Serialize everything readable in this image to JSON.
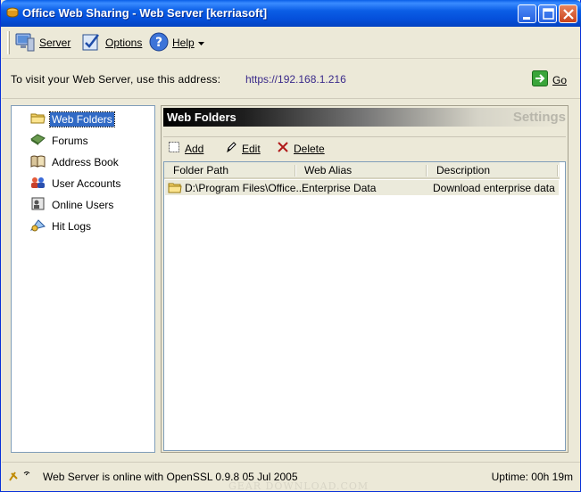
{
  "window": {
    "title": "Office Web Sharing - Web Server [kerriasoft]"
  },
  "toolbar": {
    "server_label": "Server",
    "options_label": "Options",
    "help_label": "Help"
  },
  "address": {
    "label": "To visit your Web Server, use this address:",
    "url": "https://192.168.1.216",
    "go_label": "Go"
  },
  "nav": {
    "items": [
      {
        "label": "Web Folders",
        "icon": "folder-icon",
        "selected": true
      },
      {
        "label": "Forums",
        "icon": "forums-icon"
      },
      {
        "label": "Address Book",
        "icon": "address-book-icon"
      },
      {
        "label": "User Accounts",
        "icon": "user-accounts-icon"
      },
      {
        "label": "Online Users",
        "icon": "online-users-icon"
      },
      {
        "label": "Hit Logs",
        "icon": "hit-logs-icon"
      }
    ]
  },
  "panel": {
    "title": "Web Folders",
    "settings_label": "Settings",
    "actions": {
      "add_label": "Add",
      "edit_label": "Edit",
      "delete_label": "Delete"
    },
    "columns": [
      "Folder Path",
      "Web Alias",
      "Description"
    ],
    "rows": [
      {
        "folder_path": "D:\\Program Files\\Office...",
        "web_alias": "Enterprise Data",
        "description": "Download enterprise data"
      }
    ]
  },
  "status": {
    "message": "Web Server is online with OpenSSL 0.9.8 05 Jul 2005",
    "uptime": "Uptime: 00h 19m",
    "watermark": "GEAR DOWNLOAD.COM"
  },
  "colors": {
    "titlebar": "#0550db",
    "selection": "#316ac5",
    "url_text": "#3a2a8a"
  }
}
